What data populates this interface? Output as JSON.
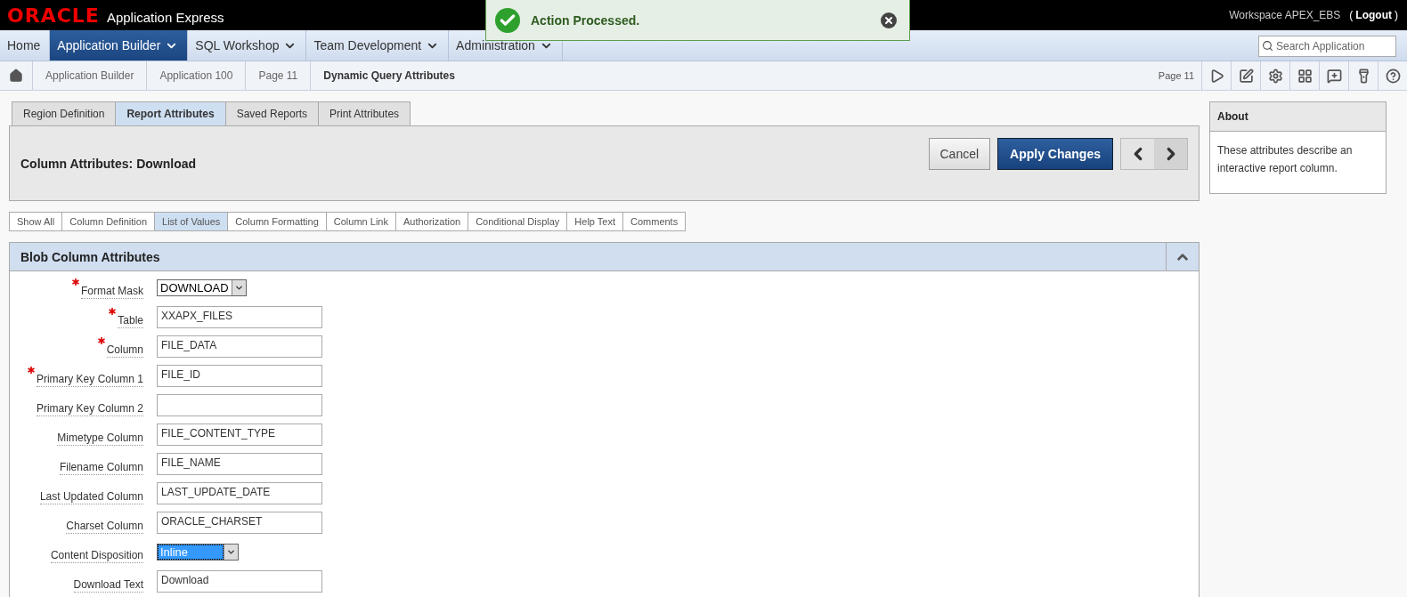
{
  "header": {
    "logo": "ORACLE",
    "product": "Application Express",
    "workspace": "Workspace APEX_EBS",
    "logout_open": "(",
    "logout": "Logout",
    "logout_close": ")"
  },
  "notification": {
    "message": "Action Processed."
  },
  "nav": {
    "items": [
      {
        "label": "Home",
        "selected": false,
        "menu": false
      },
      {
        "label": "Application Builder",
        "selected": true,
        "menu": true
      },
      {
        "label": "SQL Workshop",
        "selected": false,
        "menu": true
      },
      {
        "label": "Team Development",
        "selected": false,
        "menu": true
      },
      {
        "label": "Administration",
        "selected": false,
        "menu": true
      }
    ],
    "search": {
      "placeholder": "Search Application"
    }
  },
  "breadcrumb": {
    "items": [
      {
        "label": "Application Builder",
        "current": false
      },
      {
        "label": "Application 100",
        "current": false
      },
      {
        "label": "Page 11",
        "current": false
      },
      {
        "label": "Dynamic Query Attributes",
        "current": true
      }
    ],
    "page_label": "Page 11"
  },
  "tabs": [
    {
      "label": "Region Definition",
      "selected": false
    },
    {
      "label": "Report Attributes",
      "selected": true
    },
    {
      "label": "Saved Reports",
      "selected": false
    },
    {
      "label": "Print Attributes",
      "selected": false
    }
  ],
  "title_panel": {
    "title": "Column Attributes: Download",
    "cancel": "Cancel",
    "apply": "Apply Changes"
  },
  "subtabs": [
    {
      "label": "Show All",
      "selected": false
    },
    {
      "label": "Column Definition",
      "selected": false
    },
    {
      "label": "List of Values",
      "selected": true
    },
    {
      "label": "Column Formatting",
      "selected": false
    },
    {
      "label": "Column Link",
      "selected": false
    },
    {
      "label": "Authorization",
      "selected": false
    },
    {
      "label": "Conditional Display",
      "selected": false
    },
    {
      "label": "Help Text",
      "selected": false
    },
    {
      "label": "Comments",
      "selected": false
    }
  ],
  "region": {
    "title": "Blob Column Attributes",
    "fields": [
      {
        "label": "Format Mask",
        "required": true,
        "kind": "select",
        "value": "DOWNLOAD",
        "focused": false
      },
      {
        "label": "Table",
        "required": true,
        "kind": "text",
        "value": "XXAPX_FILES"
      },
      {
        "label": "Column",
        "required": true,
        "kind": "text",
        "value": "FILE_DATA"
      },
      {
        "label": "Primary Key Column 1",
        "required": true,
        "kind": "text",
        "value": "FILE_ID"
      },
      {
        "label": "Primary Key Column 2",
        "required": false,
        "kind": "text"
      },
      {
        "label": "Mimetype Column",
        "required": false,
        "kind": "text",
        "value": "FILE_CONTENT_TYPE"
      },
      {
        "label": "Filename Column",
        "required": false,
        "kind": "text",
        "value": "FILE_NAME"
      },
      {
        "label": "Last Updated Column",
        "required": false,
        "kind": "text",
        "value": "LAST_UPDATE_DATE"
      },
      {
        "label": "Charset Column",
        "required": false,
        "kind": "text",
        "value": "ORACLE_CHARSET"
      },
      {
        "label": "Content Disposition",
        "required": false,
        "kind": "select",
        "value": "Inline",
        "focused": true
      },
      {
        "label": "Download Text",
        "required": false,
        "kind": "text",
        "value": "Download"
      }
    ]
  },
  "about": {
    "title": "About",
    "text": "These attributes describe an interactive report column."
  }
}
